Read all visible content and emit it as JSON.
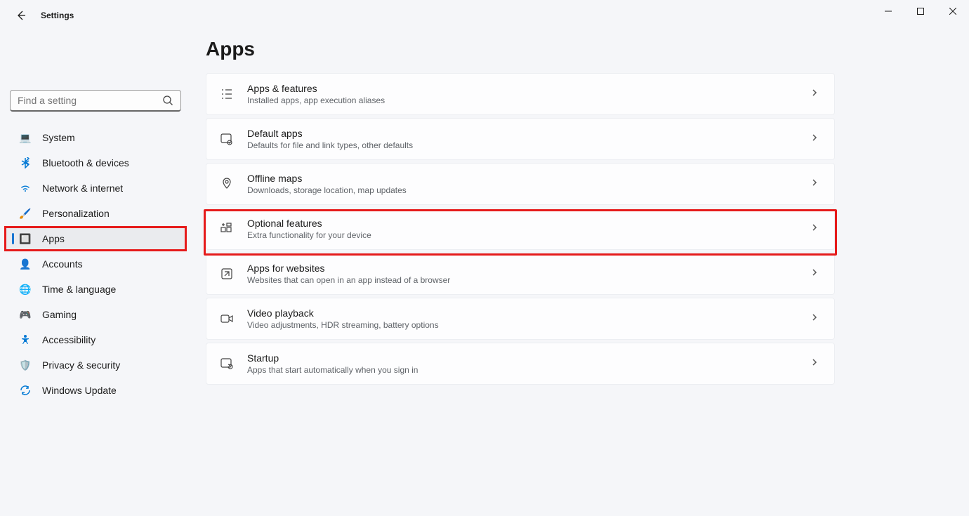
{
  "app_title": "Settings",
  "page_title": "Apps",
  "search_placeholder": "Find a setting",
  "sidebar": [
    {
      "icon": "💻",
      "label": "System"
    },
    {
      "icon": "🟦",
      "label": "Bluetooth & devices",
      "icon_css": "bt"
    },
    {
      "icon": "📶",
      "label": "Network & internet",
      "icon_css": "wifi"
    },
    {
      "icon": "🖌️",
      "label": "Personalization"
    },
    {
      "icon": "🔲",
      "label": "Apps",
      "selected": true
    },
    {
      "icon": "👤",
      "label": "Accounts"
    },
    {
      "icon": "🌐",
      "label": "Time & language"
    },
    {
      "icon": "🎮",
      "label": "Gaming"
    },
    {
      "icon": "🚹",
      "label": "Accessibility",
      "icon_css": "acc"
    },
    {
      "icon": "🛡️",
      "label": "Privacy & security"
    },
    {
      "icon": "🔄",
      "label": "Windows Update",
      "icon_css": "upd"
    }
  ],
  "panels": [
    {
      "key": "apps-features",
      "title": "Apps & features",
      "desc": "Installed apps, app execution aliases"
    },
    {
      "key": "default-apps",
      "title": "Default apps",
      "desc": "Defaults for file and link types, other defaults"
    },
    {
      "key": "offline-maps",
      "title": "Offline maps",
      "desc": "Downloads, storage location, map updates"
    },
    {
      "key": "optional-features",
      "title": "Optional features",
      "desc": "Extra functionality for your device",
      "highlighted": true
    },
    {
      "key": "apps-websites",
      "title": "Apps for websites",
      "desc": "Websites that can open in an app instead of a browser"
    },
    {
      "key": "video-playback",
      "title": "Video playback",
      "desc": "Video adjustments, HDR streaming, battery options"
    },
    {
      "key": "startup",
      "title": "Startup",
      "desc": "Apps that start automatically when you sign in"
    }
  ]
}
